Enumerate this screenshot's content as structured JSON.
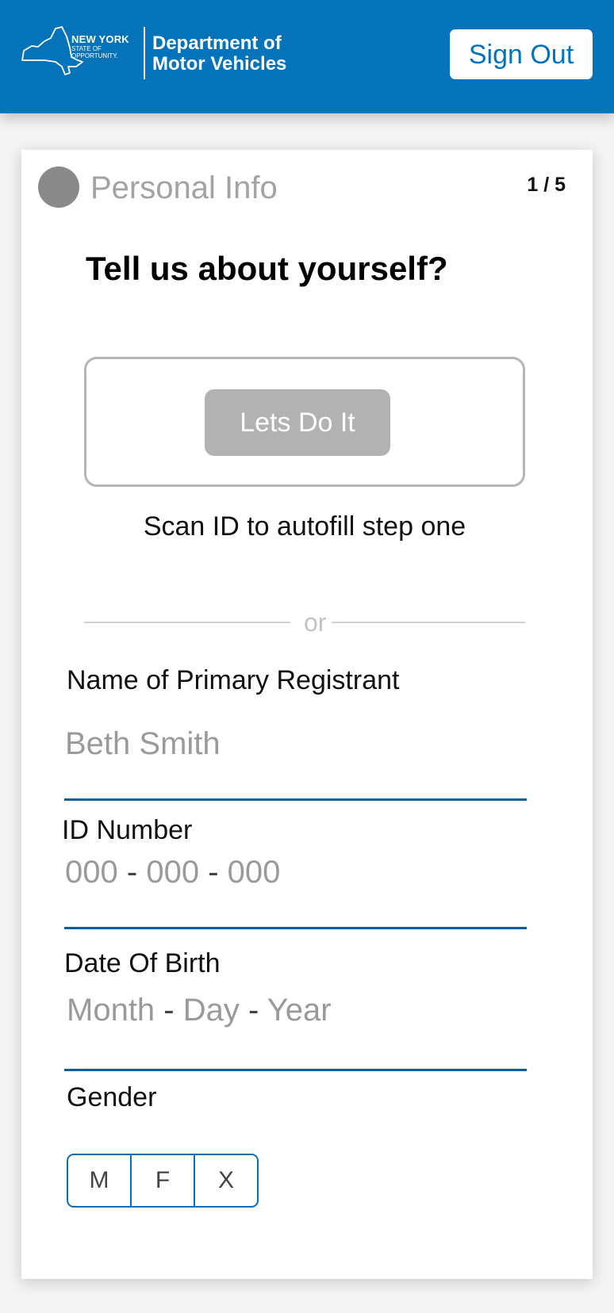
{
  "header": {
    "logo": {
      "state_name": "NEW YORK",
      "tagline": "STATE OF OPPORTUNITY.",
      "department": "Department of Motor Vehicles"
    },
    "sign_out_label": "Sign Out",
    "background_color": "#0473b9"
  },
  "step": {
    "title": "Personal Info",
    "count": "1 / 5"
  },
  "heading": "Tell us about yourself?",
  "scan": {
    "button_label": "Lets Do It",
    "caption": "Scan ID to autofill step one"
  },
  "divider_text": "or",
  "fields": {
    "name": {
      "label": "Name of Primary Registrant",
      "placeholder": "Beth Smith"
    },
    "id_number": {
      "label": "ID Number",
      "parts": [
        "000",
        "000",
        "000"
      ],
      "separator": "-"
    },
    "dob": {
      "label": "Date Of Birth",
      "parts": [
        "Month",
        "Day",
        "Year"
      ],
      "separator": "-"
    },
    "gender": {
      "label": "Gender",
      "options": [
        "M",
        "F",
        "X"
      ]
    }
  }
}
